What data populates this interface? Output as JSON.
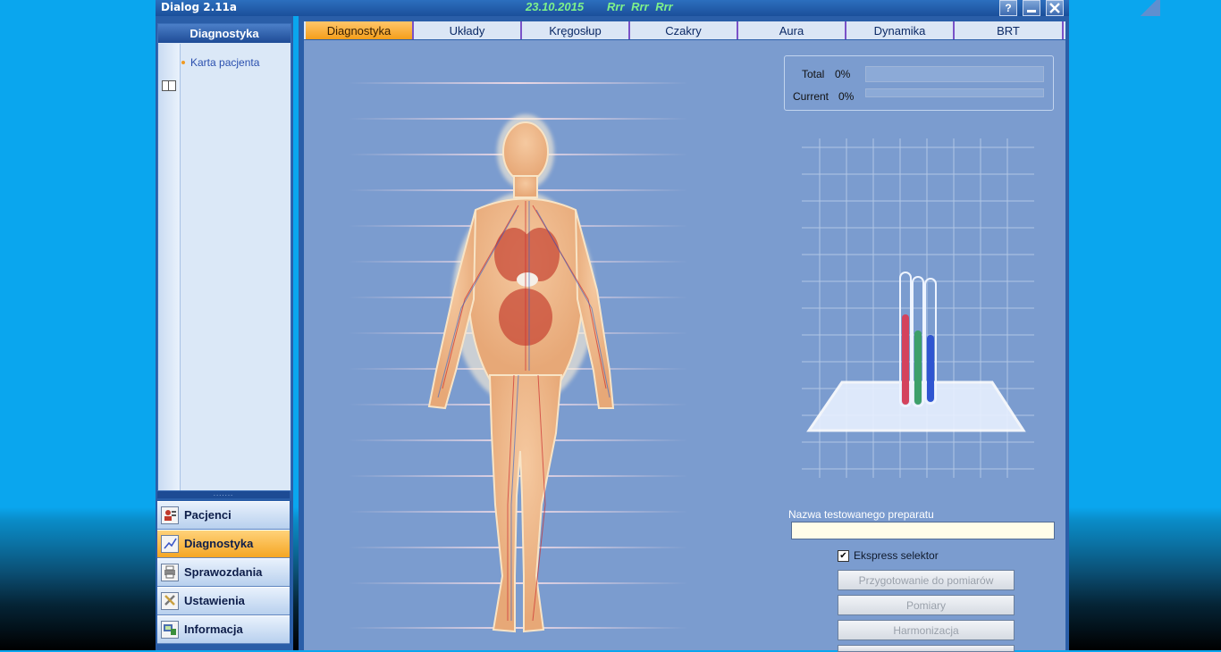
{
  "titlebar": {
    "title": "Dialog 2.11a",
    "date": "23.10.2015",
    "status": "Rrr Rrr Rrr",
    "help_icon": "?",
    "minimize_icon": "minimize-icon",
    "close_icon": "close-icon"
  },
  "left": {
    "header": "Diagnostyka",
    "items": [
      {
        "label": "Karta pacjenta",
        "icon": "book-icon"
      }
    ],
    "splitter_dots": ".......",
    "nav": [
      {
        "label": "Pacjenci",
        "icon": "patients-icon",
        "active": false
      },
      {
        "label": "Diagnostyka",
        "icon": "diagnostics-icon",
        "active": true
      },
      {
        "label": "Sprawozdania",
        "icon": "printer-icon",
        "active": false
      },
      {
        "label": "Ustawienia",
        "icon": "tools-icon",
        "active": false
      },
      {
        "label": "Informacja",
        "icon": "info-icon",
        "active": false
      }
    ]
  },
  "tabs": [
    "Diagnostyka",
    "Układy",
    "Kręgosłup",
    "Czakry",
    "Aura",
    "Dynamika",
    "BRT"
  ],
  "active_tab": "Diagnostyka",
  "progress": {
    "total_label": "Total",
    "total_value": "0%",
    "total_fraction": 0,
    "current_label": "Current",
    "current_value": "0%",
    "current_fraction": 0
  },
  "preparation": {
    "label": "Nazwa testowanego preparatu",
    "value": ""
  },
  "express": {
    "label": "Ekspress selektor",
    "checked": true
  },
  "buttons": [
    "Przygotowanie do pomiarów",
    "Pomiary",
    "Harmonizacja"
  ],
  "colors": {
    "accent": "#f5a623",
    "panel": "#7b9ccf",
    "frame": "#2a5ea8"
  }
}
